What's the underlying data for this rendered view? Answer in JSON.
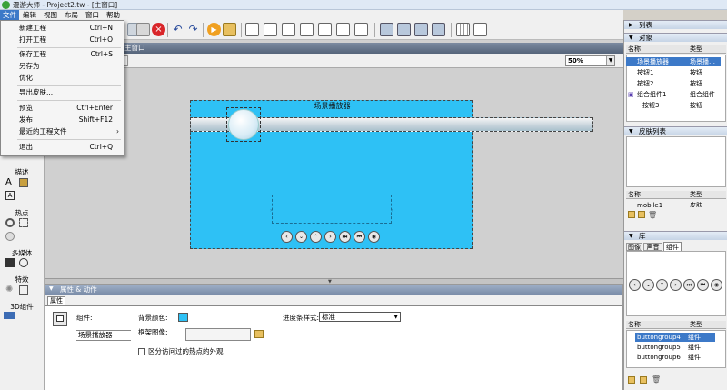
{
  "window": {
    "title": "漫游大师 - Project2.tw - [主窗口]"
  },
  "menubar": [
    {
      "label": "文件",
      "active": true
    },
    {
      "label": "编辑"
    },
    {
      "label": "视图"
    },
    {
      "label": "布局"
    },
    {
      "label": "窗口"
    },
    {
      "label": "帮助"
    }
  ],
  "file_menu": {
    "new": {
      "label": "新建工程",
      "shortcut": "Ctrl+N"
    },
    "open": {
      "label": "打开工程",
      "shortcut": "Ctrl+O"
    },
    "save": {
      "label": "保存工程",
      "shortcut": "Ctrl+S"
    },
    "saveas": {
      "label": "另存为"
    },
    "optimize": {
      "label": "优化"
    },
    "export_skin": {
      "label": "导出皮肤..."
    },
    "preview": {
      "label": "预览",
      "shortcut": "Ctrl+Enter"
    },
    "publish": {
      "label": "发布",
      "shortcut": "Shift+F12"
    },
    "recent": {
      "label": "最近的工程文件",
      "arrow": "›"
    },
    "exit": {
      "label": "退出",
      "shortcut": "Ctrl+Q"
    }
  },
  "doc": {
    "tab_label": "主窗口",
    "zoom": "50%"
  },
  "left_tools": {
    "describe": "描述",
    "hotspot": "热点",
    "multimedia": "多媒体",
    "effects": "特效",
    "comp3d": "3D组件"
  },
  "stage": {
    "title": "场景播放器"
  },
  "nav_buttons": [
    "‹",
    "⌄",
    "⌃",
    "›",
    "⏭",
    "⏮",
    "◉"
  ],
  "properties": {
    "panel_title": "属性 & 动作",
    "tab": "属性",
    "component_label": "组件:",
    "component_value": "场景播放器",
    "bgcolor_label": "背景颜色:",
    "frame_image_label": "框架图像:",
    "checkbox_label": "区分访问过的热点的外观",
    "progress_style_label": "进度条样式:",
    "progress_style_value": "标准"
  },
  "right": {
    "list_title": "列表",
    "objects_title": "对象",
    "col_name": "名称",
    "col_type": "类型",
    "objects": [
      {
        "name": "场景播放器",
        "type": "场景播…",
        "selected": true
      },
      {
        "name": "按钮1",
        "type": "按钮"
      },
      {
        "name": "按钮2",
        "type": "按钮"
      },
      {
        "name": "组合组件1",
        "type": "组合组件"
      },
      {
        "name": "按钮3",
        "type": "按钮"
      }
    ],
    "skin_title": "皮肤列表",
    "skins": [
      {
        "name": "mobile1",
        "type": "皮肤"
      }
    ],
    "library_title": "库",
    "library_tabs": [
      "图像",
      "声音",
      "组件"
    ],
    "library_items": [
      {
        "name": "buttongroup4",
        "type": "组件",
        "selected": true
      },
      {
        "name": "buttongroup5",
        "type": "组件"
      },
      {
        "name": "buttongroup6",
        "type": "组件"
      }
    ]
  }
}
